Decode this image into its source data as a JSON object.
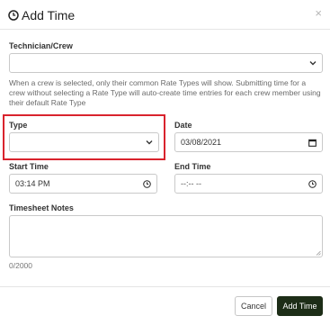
{
  "modal": {
    "title": "Add Time",
    "close_glyph": "×"
  },
  "form": {
    "technician_label": "Technician/Crew",
    "technician_value": "",
    "help_text": "When a crew is selected, only their common Rate Types will show. Submitting time for a crew without selecting a Rate Type will auto-create time entries for each crew member using their default Rate Type",
    "type_label": "Type",
    "type_value": "",
    "date_label": "Date",
    "date_value": "03/08/2021",
    "start_time_label": "Start Time",
    "start_time_value": "03:14 PM",
    "end_time_label": "End Time",
    "end_time_placeholder": "--:-- --",
    "notes_label": "Timesheet Notes",
    "notes_value": "",
    "notes_counter": "0/2000"
  },
  "footer": {
    "cancel_label": "Cancel",
    "submit_label": "Add Time"
  },
  "icons": {
    "title_icon": "clock-icon",
    "select_icon": "chevron-down-icon",
    "date_icon": "calendar-icon",
    "time_icon": "clock-icon",
    "close_icon": "close-icon"
  },
  "colors": {
    "highlight_border": "#d9232d",
    "primary_button": "#1d2d17",
    "divider": "#e5e5e5",
    "help_text": "#6a6a6a"
  }
}
